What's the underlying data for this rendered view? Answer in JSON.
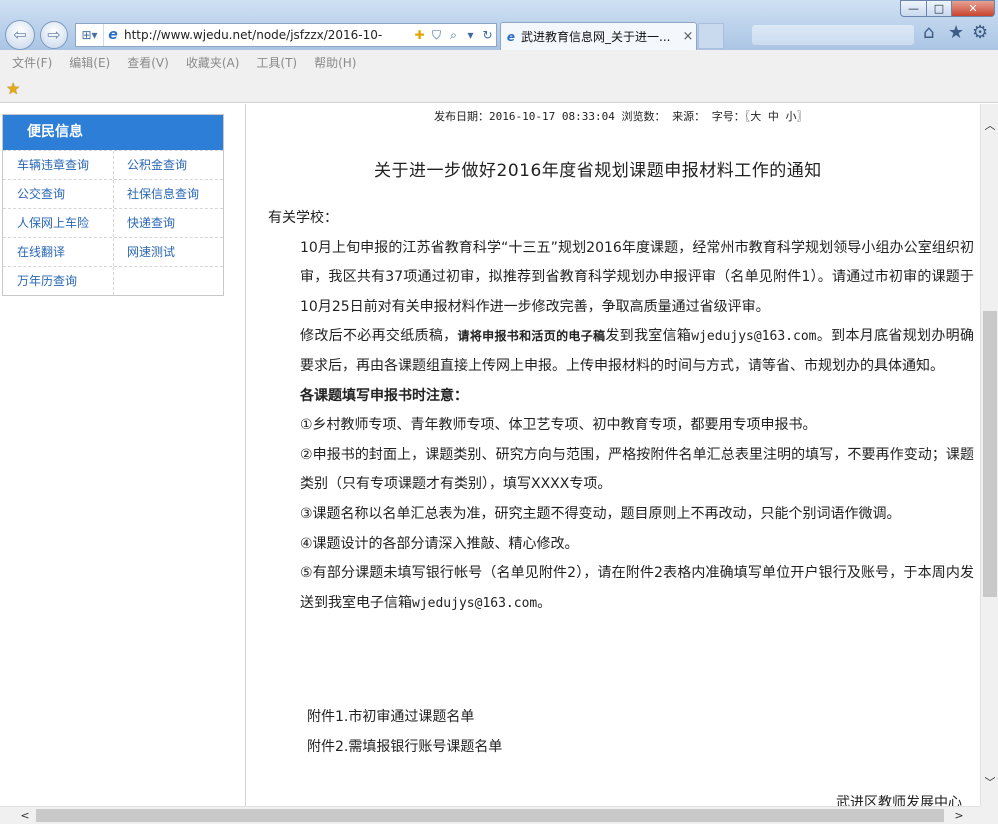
{
  "window": {
    "minimize": "—",
    "maximize": "□",
    "close": "✕"
  },
  "addressbar": {
    "url": "http://www.wjedu.net/node/jsfzzx/2016-10-",
    "compat_icon": "compat-view-icon",
    "plugin_icon": "plugin-icon",
    "shield_icon": "shield-icon",
    "search_icon": "search-icon",
    "refresh_icon": "refresh-icon"
  },
  "tab": {
    "title": "武进教育信息网_关于进一...",
    "close": "×"
  },
  "menu": [
    "文件(F)",
    "编辑(E)",
    "查看(V)",
    "收藏夹(A)",
    "工具(T)",
    "帮助(H)"
  ],
  "sidebar": {
    "header": "便民信息",
    "rows": [
      [
        "车辆违章查询",
        "公积金查询"
      ],
      [
        "公交查询",
        "社保信息查询"
      ],
      [
        "人保网上车险",
        "快递查询"
      ],
      [
        "在线翻译",
        "网速测试"
      ],
      [
        "万年历查询",
        ""
      ]
    ]
  },
  "article": {
    "meta": "发布日期：2016-10-17 08:33:04 浏览数： 来源： 字号：〖大 中 小〗",
    "title": "关于进一步做好2016年度省规划课题申报材料工作的通知",
    "salutation": "有关学校：",
    "p1": "10月上旬申报的江苏省教育科学“十三五”规划2016年度课题，经常州市教育科学规划领导小组办公室组织初审，我区共有37项通过初审，拟推荐到省教育科学规划办申报评审（名单见附件1）。请通过市初审的课题于10月25日前对有关申报材料作进一步修改完善，争取高质量通过省级评审。",
    "p2_a": "修改后不必再交纸质稿，",
    "p2_b": "请将申报书和活页的电子稿",
    "p2_c": "发到我室信箱",
    "p2_email": "wjedujys@163.com",
    "p2_d": "。到本月底省规划办明确要求后，再由各课题组直接上传网上申报。上传申报材料的时间与方式，请等省、市规划办的具体通知。",
    "notice_heading": "各课题填写申报书时注意：",
    "n1": "①乡村教师专项、青年教师专项、体卫艺专项、初中教育专项，都要用专项申报书。",
    "n2": "②申报书的封面上，课题类别、研究方向与范围，严格按附件名单汇总表里注明的填写，不要再作变动；课题类别（只有专项课题才有类别），填写XXXX专项。",
    "n3": "③课题名称以名单汇总表为准，研究主题不得变动，题目原则上不再改动，只能个别词语作微调。",
    "n4": "④课题设计的各部分请深入推敲、精心修改。",
    "n5_a": "⑤有部分课题未填写银行帐号（名单见附件2），请在附件2表格内准确填写单位开户银行及账号，于本周内发送到我室电子信箱",
    "n5_email": "wjedujys@163.com",
    "n5_b": "。",
    "attachment1": "附件1.市初审通过课题名单",
    "attachment2": "附件2.需填报银行账号课题名单",
    "signature": "武进区教师发展中心"
  },
  "colors": {
    "sidebar_header": "#2c7ed6",
    "sidebar_link": "#2a67b5",
    "chrome": "#b9d0ea"
  }
}
